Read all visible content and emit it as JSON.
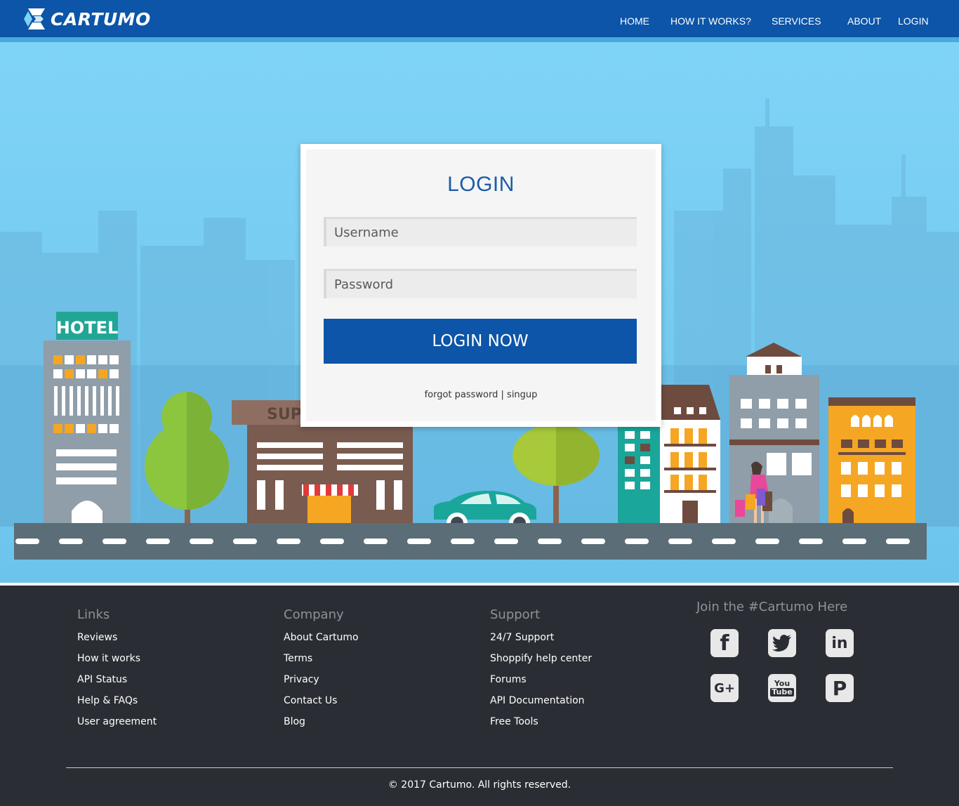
{
  "brand": {
    "name": "CARTUMO"
  },
  "nav": {
    "items": [
      {
        "label": "HOME"
      },
      {
        "label": "HOW IT WORKS?"
      },
      {
        "label": "SERVICES"
      },
      {
        "label": "ABOUT"
      },
      {
        "label": "LOGIN"
      }
    ]
  },
  "illustration": {
    "hotel_sign": "HOTEL",
    "store_sign": "SUP"
  },
  "login": {
    "title": "LOGIN",
    "username_placeholder": "Username",
    "password_placeholder": "Password",
    "submit_label": "LOGIN NOW",
    "forgot_label": "forgot password",
    "separator": "|",
    "signup_label": "singup"
  },
  "footer": {
    "columns": [
      {
        "title": "Links",
        "links": [
          "Reviews",
          "How it works",
          "API Status",
          "Help & FAQs",
          "User agreement"
        ]
      },
      {
        "title": "Company",
        "links": [
          "About Cartumo",
          "Terms",
          "Privacy",
          "Contact Us",
          "Blog"
        ]
      },
      {
        "title": "Support",
        "links": [
          "24/7 Support",
          "Shoppify help center",
          "Forums",
          "API Documentation",
          "Free Tools"
        ]
      }
    ],
    "social": {
      "title": "Join the #Cartumo Here",
      "icons": [
        "facebook-icon",
        "twitter-icon",
        "linkedin-icon",
        "google-plus-icon",
        "youtube-icon",
        "pinterest-icon"
      ]
    },
    "copyright": "© 2017 Cartumo. All rights reserved."
  },
  "colors": {
    "header": "#0c55a8",
    "sky": "#7fd2f5",
    "footer": "#2a2d33",
    "accent": "#1a5ca8"
  }
}
